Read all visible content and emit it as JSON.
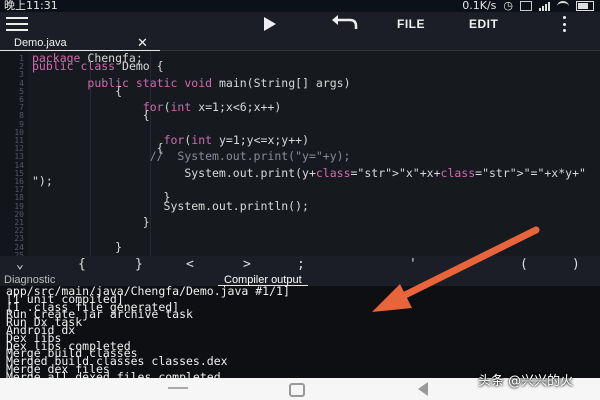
{
  "status_bar": {
    "time": "晚上11:31",
    "network_speed": "0.1K/s",
    "icons": [
      "clock-icon",
      "sim-icon",
      "signal-icon",
      "wifi-icon",
      "battery-icon"
    ]
  },
  "toolbar": {
    "run_icon": "play-icon",
    "undo_icon": "undo-icon",
    "file_label": "FILE",
    "edit_label": "EDIT",
    "menu_icon": "hamburger-icon",
    "overflow_icon": "more-vertical-icon"
  },
  "tab": {
    "name": "Demo.java",
    "close_symbol": "✕"
  },
  "code_lines": [
    {
      "n": "1",
      "text": "package Chengfa;"
    },
    {
      "n": "2",
      "text": "public class Demo {"
    },
    {
      "n": "3",
      "text": ""
    },
    {
      "n": "4",
      "text": "        public static void main(String[] args)"
    },
    {
      "n": "5",
      "text": "            {"
    },
    {
      "n": "6",
      "text": ""
    },
    {
      "n": "7",
      "text": "                for(int x=1;x<6;x++)"
    },
    {
      "n": "8",
      "text": "                {"
    },
    {
      "n": "9",
      "text": ""
    },
    {
      "n": "10",
      "text": ""
    },
    {
      "n": "11",
      "text": "                   for(int y=1;y<=x;y++)"
    },
    {
      "n": "12",
      "text": "                  {"
    },
    {
      "n": "13",
      "text": "                 //  System.out.print(\"y=\"+y);"
    },
    {
      "n": "14",
      "text": ""
    },
    {
      "n": "15",
      "text": "                      System.out.print(y+\"x\"+x+\"=\"+x*y+\""
    },
    {
      "n": "16",
      "text": "\");"
    },
    {
      "n": "17",
      "text": ""
    },
    {
      "n": "18",
      "text": "                   }"
    },
    {
      "n": "19",
      "text": "                   System.out.println();"
    },
    {
      "n": "20",
      "text": ""
    },
    {
      "n": "21",
      "text": "                }"
    },
    {
      "n": "22",
      "text": ""
    },
    {
      "n": "23",
      "text": ""
    },
    {
      "n": "24",
      "text": "            }"
    },
    {
      "n": "25",
      "text": ""
    }
  ],
  "symbol_bar": [
    "⌄",
    "{",
    "}",
    "<",
    ">",
    ";",
    "'",
    "(",
    ")"
  ],
  "panel_tabs": {
    "diagnostic": "Diagnostic",
    "compiler_output": "Compiler output"
  },
  "output_lines": [
    "app/src/main/java/Chengfa/Demo.java #1/1]",
    "[1 unit compiled]",
    "[1 .class file generated]",
    "Run Create jar archive task",
    "Run Dx task",
    "Android dx",
    "Dex libs",
    "Dex libs completed",
    "Merge build classes",
    "Merged build classes classes.dex",
    "Merge dex files",
    "Merge all dexed files completed"
  ],
  "watermark": "头条 @兴兴的火",
  "colors": {
    "arrow": "#e8643a",
    "editor_bg": "#161a1f",
    "keyword": "#d06ab0",
    "string": "#e8d660"
  }
}
